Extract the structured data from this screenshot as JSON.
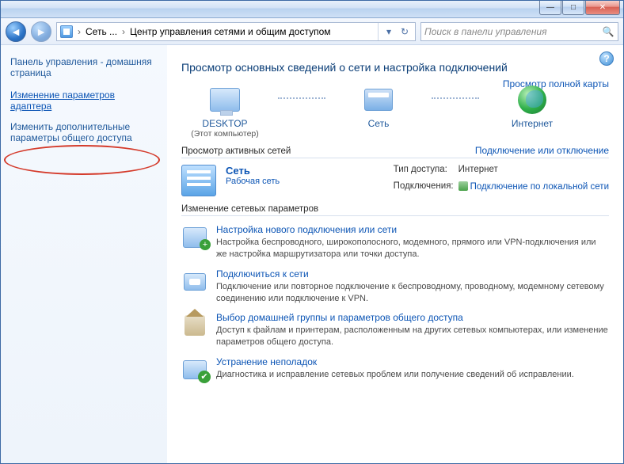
{
  "titlebar": {
    "min": "—",
    "max": "□",
    "close": "✕"
  },
  "nav": {
    "back_glyph": "◄",
    "fwd_glyph": "►",
    "crumb1": "Сеть ...",
    "crumb2": "Центр управления сетями и общим доступом",
    "sep": "›",
    "dropdown_glyph": "▾",
    "refresh_glyph": "↻"
  },
  "search": {
    "placeholder": "Поиск в панели управления",
    "mag": "🔍"
  },
  "sidebar": {
    "home": "Панель управления - домашняя страница",
    "link1": "Изменение параметров адаптера",
    "link2": "Изменить дополнительные параметры общего доступа"
  },
  "help_glyph": "?",
  "main": {
    "title": "Просмотр основных сведений о сети и настройка подключений",
    "full_map_link": "Просмотр полной карты",
    "nodes": {
      "desktop": "DESKTOP",
      "desktop_sub": "(Этот компьютер)",
      "network": "Сеть",
      "internet": "Интернет"
    },
    "active_section": "Просмотр активных сетей",
    "active_right": "Подключение или отключение",
    "net": {
      "name": "Сеть",
      "type": "Рабочая сеть",
      "k1": "Тип доступа:",
      "v1": "Интернет",
      "k2": "Подключения:",
      "v2": "Подключение по локальной сети"
    },
    "change_section": "Изменение сетевых параметров",
    "tasks": [
      {
        "title": "Настройка нового подключения или сети",
        "desc": "Настройка беспроводного, широкополосного, модемного, прямого или VPN-подключения или же настройка маршрутизатора или точки доступа."
      },
      {
        "title": "Подключиться к сети",
        "desc": "Подключение или повторное подключение к беспроводному, проводному, модемному сетевому соединению или подключение к VPN."
      },
      {
        "title": "Выбор домашней группы и параметров общего доступа",
        "desc": "Доступ к файлам и принтерам, расположенным на других сетевых компьютерах, или изменение параметров общего доступа."
      },
      {
        "title": "Устранение неполадок",
        "desc": "Диагностика и исправление сетевых проблем или получение сведений об исправлении."
      }
    ]
  }
}
